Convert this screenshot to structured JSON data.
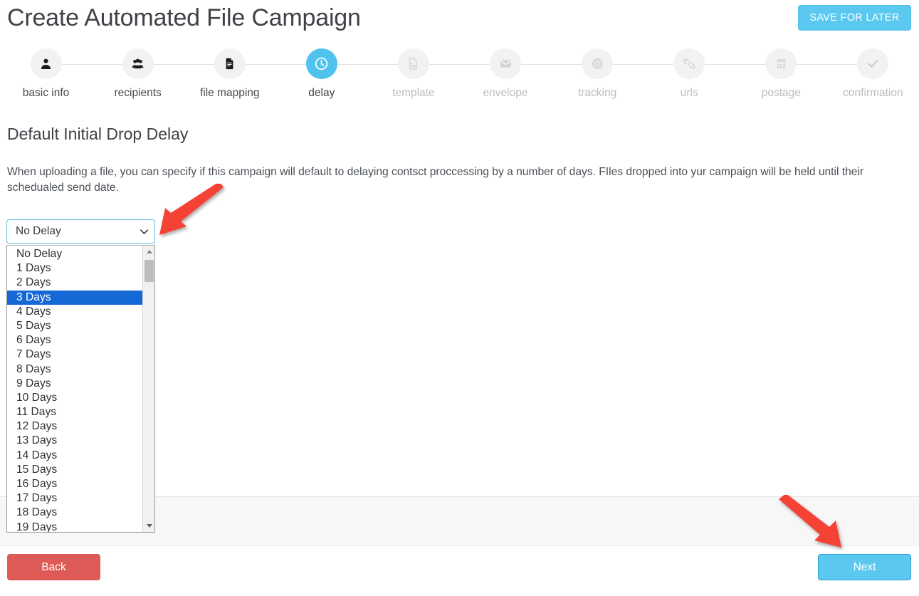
{
  "header": {
    "title": "Create Automated File Campaign",
    "save_for_later_label": "SAVE FOR LATER"
  },
  "stepper": {
    "steps": [
      {
        "label": "basic info",
        "icon": "user-icon",
        "state": "done"
      },
      {
        "label": "recipients",
        "icon": "users-icon",
        "state": "done"
      },
      {
        "label": "file mapping",
        "icon": "file-text-icon",
        "state": "done"
      },
      {
        "label": "delay",
        "icon": "clock-icon",
        "state": "active"
      },
      {
        "label": "template",
        "icon": "image-file-icon",
        "state": "future"
      },
      {
        "label": "envelope",
        "icon": "envelope-icon",
        "state": "future"
      },
      {
        "label": "tracking",
        "icon": "target-icon",
        "state": "future"
      },
      {
        "label": "urls",
        "icon": "link-icon",
        "state": "future"
      },
      {
        "label": "postage",
        "icon": "stamp-icon",
        "state": "future"
      },
      {
        "label": "confirmation",
        "icon": "check-icon",
        "state": "future"
      }
    ]
  },
  "main": {
    "section_title": "Default Initial Drop Delay",
    "description": "When uploading a file, you can specify if this campaign will default to delaying contsct proccessing by a number of days. FIles dropped into yur campaign will be held until their schedualed send date.",
    "delay_select": {
      "selected_value": "No Delay",
      "highlighted_option": "3 Days",
      "chevron_icon": "chevron-down-icon",
      "scrollbar": {
        "up_icon": "scroll-up-arrow-icon",
        "down_icon": "scroll-down-arrow-icon"
      },
      "options": [
        "No Delay",
        "1 Days",
        "2 Days",
        "3 Days",
        "4 Days",
        "5 Days",
        "6 Days",
        "7 Days",
        "8 Days",
        "9 Days",
        "10 Days",
        "11 Days",
        "12 Days",
        "13 Days",
        "14 Days",
        "15 Days",
        "16 Days",
        "17 Days",
        "18 Days",
        "19 Days"
      ]
    }
  },
  "footer": {
    "back_label": "Back",
    "next_label": "Next"
  },
  "annotations": [
    {
      "name": "arrow-pointing-to-delay-select",
      "color": "#f44336"
    },
    {
      "name": "arrow-pointing-to-next-button",
      "color": "#f44336"
    }
  ],
  "colors": {
    "accent_blue": "#5bc8ef",
    "active_step": "#4fc3ed",
    "back_red": "#dd5a56",
    "option_highlight": "#1569d6",
    "annotation_red": "#f44336"
  }
}
